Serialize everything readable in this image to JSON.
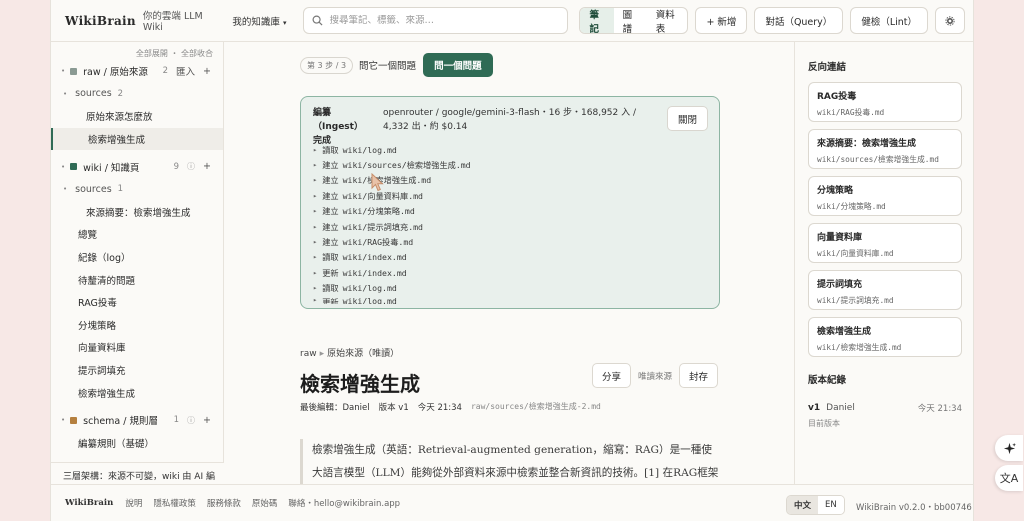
{
  "app": {
    "logo": "WikiBrain",
    "tagline": "你的雲端 LLM Wiki",
    "workspace": "我的知識庫"
  },
  "search": {
    "placeholder": "搜尋筆記、標籤、來源…"
  },
  "view_tabs": [
    "筆記",
    "圖譜",
    "資料表"
  ],
  "toolbar": {
    "new_label": "+ 新增",
    "chat_label": "對話（Query）",
    "lint_label": "健檢（Lint）"
  },
  "sidebar": {
    "expand_all": "全部展開",
    "collapse_all": "全部收合",
    "sections": [
      {
        "label": "raw / 原始來源",
        "count": "2",
        "action": "匯入",
        "color": "#8a9a93",
        "sub": {
          "label": "sources",
          "count": "2"
        },
        "items": [
          "原始來源怎麼放",
          "檢索增強生成"
        ]
      },
      {
        "label": "wiki / 知識頁",
        "count": "9",
        "color": "#2f6b55",
        "sub": {
          "label": "sources",
          "count": "1"
        },
        "sub_items": [
          "來源摘要：檢索增強生成"
        ],
        "items": [
          "總覽",
          "紀錄（log）",
          "待釐清的問題",
          "RAG投毒",
          "分塊策略",
          "向量資料庫",
          "提示詞填充",
          "檢索增強生成"
        ]
      },
      {
        "label": "schema / 規則層",
        "count": "1",
        "color": "#b5803f",
        "items": [
          "編纂規則（基礎）"
        ]
      }
    ],
    "footer_text": "三層架構：來源不可變，wiki 由 AI 編"
  },
  "wizard": {
    "step_chip": "第 3 步 / 3",
    "ask_other": "問它一個問題",
    "ask_button": "問一個問題"
  },
  "ingest": {
    "heading": "編纂（Ingest）完成",
    "meta": "openrouter / google/gemini-3-flash・16 步・168,952 入 / 4,332 出・約 $0.14",
    "close_label": "關閉",
    "items": [
      {
        "verb": "讀取",
        "path": "wiki/log.md"
      },
      {
        "verb": "建立",
        "path": "wiki/sources/檢索增強生成.md"
      },
      {
        "verb": "建立",
        "path": "wiki/檢索增強生成.md"
      },
      {
        "verb": "建立",
        "path": "wiki/向量資料庫.md"
      },
      {
        "verb": "建立",
        "path": "wiki/分塊策略.md"
      },
      {
        "verb": "建立",
        "path": "wiki/提示詞填充.md"
      },
      {
        "verb": "建立",
        "path": "wiki/RAG投毒.md"
      },
      {
        "verb": "讀取",
        "path": "wiki/index.md"
      },
      {
        "verb": "更新",
        "path": "wiki/index.md"
      },
      {
        "verb": "讀取",
        "path": "wiki/log.md"
      },
      {
        "verb": "更新",
        "path": "wiki/log.md"
      }
    ]
  },
  "page": {
    "crumb_root": "raw",
    "crumb_leaf": "原始來源（唯讀）",
    "title": "檢索增強生成",
    "share_label": "分享",
    "readonly_label": "唯讀來源",
    "archive_label": "封存",
    "last_edit": "最後編輯：Daniel",
    "version": "版本 v1",
    "time": "今天 21:34",
    "path": "raw/sources/檢索增強生成-2.md",
    "body": "檢索增強生成（英語：Retrieval-augmented generation，縮寫：RAG）是一種使大語言模型（LLM）能夠從外部資料來源中檢索並整合新資訊的技術。[1] 在RAG框架"
  },
  "backlinks": {
    "heading": "反向連結",
    "items": [
      {
        "title": "RAG投毒",
        "path": "wiki/RAG投毒.md"
      },
      {
        "title": "來源摘要：檢索增強生成",
        "path": "wiki/sources/檢索增強生成.md"
      },
      {
        "title": "分塊策略",
        "path": "wiki/分塊策略.md"
      },
      {
        "title": "向量資料庫",
        "path": "wiki/向量資料庫.md"
      },
      {
        "title": "提示詞填充",
        "path": "wiki/提示詞填充.md"
      },
      {
        "title": "檢索增強生成",
        "path": "wiki/檢索增強生成.md"
      }
    ]
  },
  "versions": {
    "heading": "版本紀錄",
    "v": "v1",
    "author": "Daniel",
    "date": "今天 21:34",
    "current": "目前版本"
  },
  "footer": {
    "logo": "WikiBrain",
    "links": [
      "說明",
      "隱私權政策",
      "服務條款",
      "原始碼",
      "聯絡・hello@wikibrain.app"
    ],
    "langs": [
      "中文",
      "EN"
    ],
    "version": "WikiBrain v0.2.0・bb00746"
  },
  "colors": {
    "accent": "#2f6b55",
    "ingest_border": "#8db5a3",
    "ingest_bg": "#e9f0ec"
  }
}
